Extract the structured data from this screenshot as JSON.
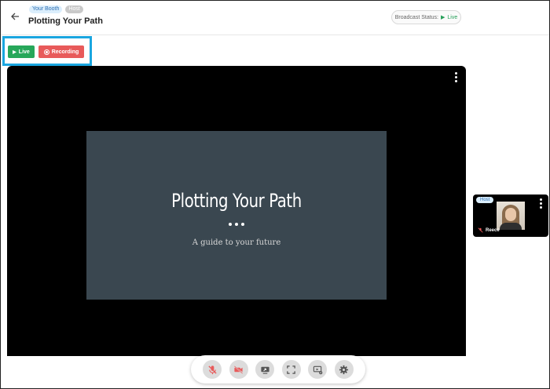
{
  "header": {
    "back_icon": "arrow-left-icon",
    "booth_badge": "Your Booth",
    "role_badge": "Host",
    "title": "Plotting Your Path",
    "broadcast_status_label": "Broadcast Status:",
    "broadcast_status_value": "Live"
  },
  "actions": {
    "live_label": "Live",
    "recording_label": "Recording"
  },
  "stage": {
    "slide_title": "Plotting Your Path",
    "slide_subtitle": "A guide to your future"
  },
  "host_tile": {
    "badge": "Host",
    "name": "Reece"
  },
  "controls": [
    {
      "name": "mic-off",
      "icon": "microphone-off-icon"
    },
    {
      "name": "camera-off",
      "icon": "video-off-icon"
    },
    {
      "name": "share-screen",
      "icon": "screen-share-icon"
    },
    {
      "name": "fullscreen",
      "icon": "fullscreen-icon"
    },
    {
      "name": "layout-settings",
      "icon": "screen-settings-icon"
    },
    {
      "name": "settings",
      "icon": "gear-icon"
    }
  ],
  "colors": {
    "live": "#27a75a",
    "recording": "#e85a5a",
    "highlight": "#1aa6e0",
    "slide_bg": "#3a4750"
  }
}
